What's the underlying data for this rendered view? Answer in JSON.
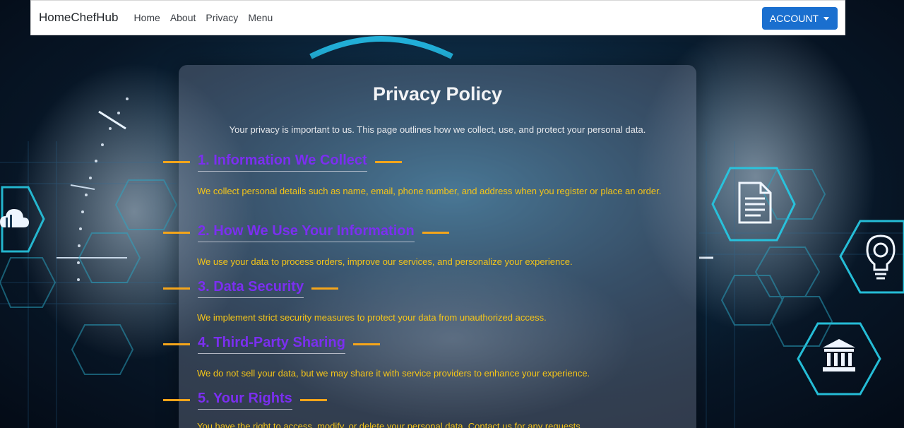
{
  "navbar": {
    "brand": "HomeChefHub",
    "links": [
      "Home",
      "About",
      "Privacy",
      "Menu"
    ],
    "account_label": "ACCOUNT"
  },
  "policy": {
    "title": "Privacy Policy",
    "intro": "Your privacy is important to us. This page outlines how we collect, use, and protect your personal data.",
    "sections": [
      {
        "heading": "1. Information We Collect",
        "body": "We collect personal details such as name, email, phone number, and address when you register or place an order."
      },
      {
        "heading": "2. How We Use Your Information",
        "body": "We use your data to process orders, improve our services, and personalize your experience."
      },
      {
        "heading": "3. Data Security",
        "body": "We implement strict security measures to protect your data from unauthorized access."
      },
      {
        "heading": "4. Third-Party Sharing",
        "body": "We do not sell your data, but we may share it with service providers to enhance your experience."
      },
      {
        "heading": "5. Your Rights",
        "body": "You have the right to access, modify, or delete your personal data. Contact us for any requests."
      }
    ]
  },
  "colors": {
    "accent": "#1a6fcf",
    "heading": "#7b2ff0",
    "body_text": "#f5c518",
    "dash": "#f5a51a",
    "hex_glow": "#27c6e0"
  },
  "icons": [
    "cloud-icon",
    "document-icon",
    "lightbulb-icon",
    "bank-icon"
  ]
}
